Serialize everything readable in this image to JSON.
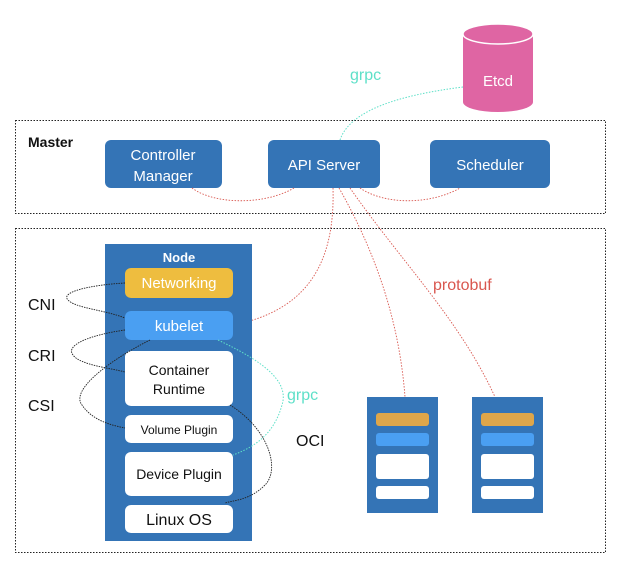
{
  "colors": {
    "blue": "#3474b6",
    "light_blue": "#4a9ff2",
    "orange": "#eebd3f",
    "pink": "#df65a3",
    "teal": "#5ee0c8",
    "red": "#d9574f"
  },
  "etcd": {
    "label": "Etcd"
  },
  "edges": {
    "grpc_top": "grpc",
    "grpc_node": "grpc",
    "protobuf": "protobuf"
  },
  "master": {
    "label": "Master",
    "controller_manager": [
      "Controller",
      "Manager"
    ],
    "api_server": "API Server",
    "scheduler": "Scheduler"
  },
  "node": {
    "label": "Node",
    "networking": "Networking",
    "kubelet": "kubelet",
    "container_runtime": [
      "Container",
      "Runtime"
    ],
    "volume_plugin": "Volume Plugin",
    "device_plugin": "Device Plugin",
    "linux_os": "Linux OS"
  },
  "interfaces": {
    "cni": "CNI",
    "cri": "CRI",
    "csi": "CSI",
    "oci": "OCI"
  }
}
